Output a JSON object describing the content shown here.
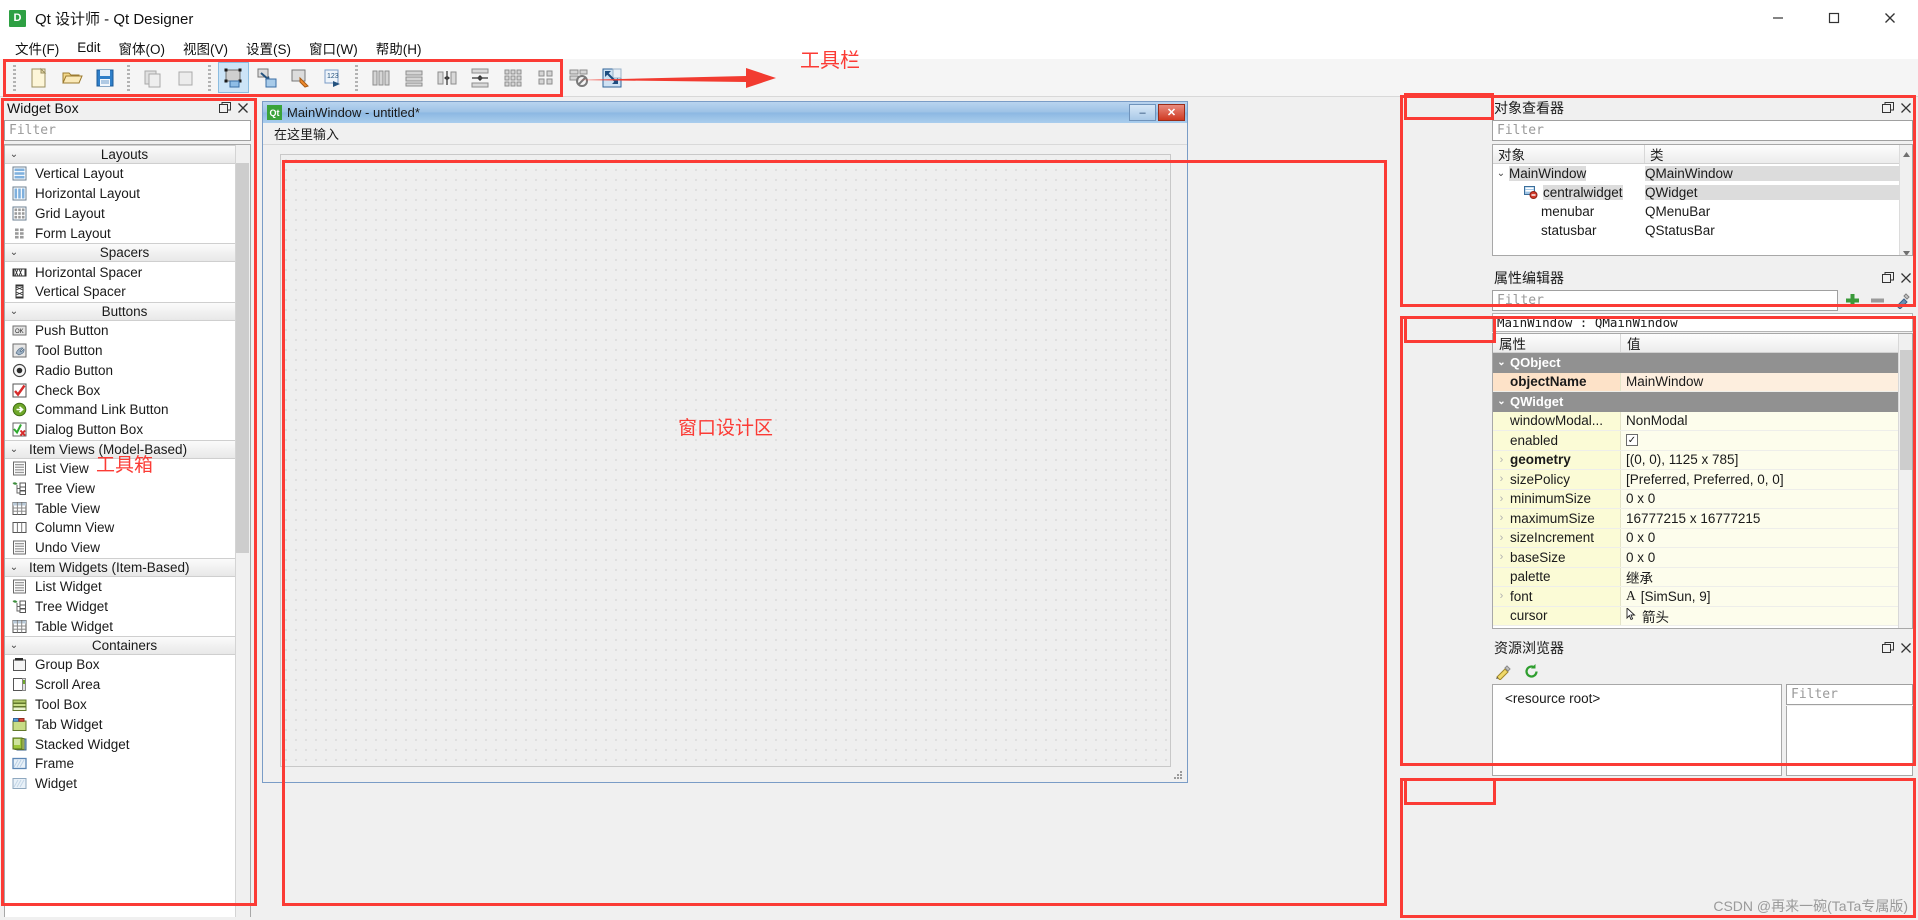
{
  "window": {
    "title": "Qt 设计师 - Qt Designer",
    "logo_letter": "D",
    "minimize_label": "minimize",
    "maximize_label": "maximize",
    "close_label": "close"
  },
  "menubar": {
    "items": [
      {
        "label": "文件(F)",
        "accel": "F"
      },
      {
        "label": "Edit",
        "accel": "E"
      },
      {
        "label": "窗体(O)",
        "accel": "O"
      },
      {
        "label": "视图(V)",
        "accel": "V"
      },
      {
        "label": "设置(S)",
        "accel": "S"
      },
      {
        "label": "窗口(W)",
        "accel": "W"
      },
      {
        "label": "帮助(H)",
        "accel": "H"
      }
    ]
  },
  "toolbar": {
    "buttons": [
      {
        "name": "new-form-icon"
      },
      {
        "name": "open-form-icon"
      },
      {
        "name": "save-form-icon"
      },
      {
        "name": "cut-copy-icon"
      },
      {
        "name": "paste-icon"
      },
      {
        "name": "edit-widgets-icon"
      },
      {
        "name": "edit-signals-slots-icon"
      },
      {
        "name": "edit-buddies-icon"
      },
      {
        "name": "edit-tab-order-icon"
      },
      {
        "name": "layout-horizontally-icon"
      },
      {
        "name": "layout-vertically-icon"
      },
      {
        "name": "layout-in-splitter-horizontal-icon"
      },
      {
        "name": "layout-in-splitter-vertical-icon"
      },
      {
        "name": "layout-in-grid-icon"
      },
      {
        "name": "layout-in-form-icon"
      },
      {
        "name": "break-layout-icon"
      },
      {
        "name": "adjust-size-icon"
      }
    ]
  },
  "annotations": {
    "toolbar_label": "工具栏",
    "widgetbox_label": "工具箱",
    "canvas_label": "窗口设计区"
  },
  "widget_box": {
    "title": "Widget Box",
    "filter_placeholder": "Filter",
    "float_label": "float",
    "close_label": "close",
    "groups": [
      {
        "name": "Layouts",
        "items": [
          {
            "label": "Vertical Layout",
            "icon": "vertical-layout-icon"
          },
          {
            "label": "Horizontal Layout",
            "icon": "horizontal-layout-icon"
          },
          {
            "label": "Grid Layout",
            "icon": "grid-layout-icon"
          },
          {
            "label": "Form Layout",
            "icon": "form-layout-icon"
          }
        ]
      },
      {
        "name": "Spacers",
        "items": [
          {
            "label": "Horizontal Spacer",
            "icon": "horizontal-spacer-icon"
          },
          {
            "label": "Vertical Spacer",
            "icon": "vertical-spacer-icon"
          }
        ]
      },
      {
        "name": "Buttons",
        "items": [
          {
            "label": "Push Button",
            "icon": "push-button-icon"
          },
          {
            "label": "Tool Button",
            "icon": "tool-button-icon"
          },
          {
            "label": "Radio Button",
            "icon": "radio-button-icon"
          },
          {
            "label": "Check Box",
            "icon": "check-box-icon"
          },
          {
            "label": "Command Link Button",
            "icon": "command-link-button-icon"
          },
          {
            "label": "Dialog Button Box",
            "icon": "dialog-button-box-icon"
          }
        ]
      },
      {
        "name": "Item Views (Model-Based)",
        "items": [
          {
            "label": "List View",
            "icon": "list-view-icon"
          },
          {
            "label": "Tree View",
            "icon": "tree-view-icon"
          },
          {
            "label": "Table View",
            "icon": "table-view-icon"
          },
          {
            "label": "Column View",
            "icon": "column-view-icon"
          },
          {
            "label": "Undo View",
            "icon": "undo-view-icon"
          }
        ]
      },
      {
        "name": "Item Widgets (Item-Based)",
        "items": [
          {
            "label": "List Widget",
            "icon": "list-widget-icon"
          },
          {
            "label": "Tree Widget",
            "icon": "tree-widget-icon"
          },
          {
            "label": "Table Widget",
            "icon": "table-widget-icon"
          }
        ]
      },
      {
        "name": "Containers",
        "items": [
          {
            "label": "Group Box",
            "icon": "group-box-icon"
          },
          {
            "label": "Scroll Area",
            "icon": "scroll-area-icon"
          },
          {
            "label": "Tool Box",
            "icon": "tool-box-icon"
          },
          {
            "label": "Tab Widget",
            "icon": "tab-widget-icon"
          },
          {
            "label": "Stacked Widget",
            "icon": "stacked-widget-icon"
          },
          {
            "label": "Frame",
            "icon": "frame-icon"
          },
          {
            "label": "Widget",
            "icon": "widget-icon"
          }
        ]
      }
    ]
  },
  "form_window": {
    "title": "MainWindow - untitled*",
    "logo_letter": "Qt",
    "minimize_label": "–",
    "close_label": "✕",
    "menu_placeholder": "在这里输入"
  },
  "object_inspector": {
    "title": "对象查看器",
    "filter_placeholder": "Filter",
    "columns": [
      "对象",
      "类"
    ],
    "rows": [
      {
        "name": "MainWindow",
        "class": "QMainWindow",
        "depth": 0,
        "expanded": true,
        "selected": true,
        "icon": ""
      },
      {
        "name": "centralwidget",
        "class": "QWidget",
        "depth": 1,
        "expanded": false,
        "selected": true,
        "icon": "central-widget-icon"
      },
      {
        "name": "menubar",
        "class": "QMenuBar",
        "depth": 1,
        "expanded": false,
        "selected": false,
        "icon": ""
      },
      {
        "name": "statusbar",
        "class": "QStatusBar",
        "depth": 1,
        "expanded": false,
        "selected": false,
        "icon": ""
      }
    ]
  },
  "property_editor": {
    "title": "属性编辑器",
    "filter_placeholder": "Filter",
    "object_line": "MainWindow : QMainWindow",
    "columns": [
      "属性",
      "值"
    ],
    "rows": [
      {
        "kind": "group",
        "name": "QObject"
      },
      {
        "kind": "prop",
        "name": "objectName",
        "value": "MainWindow",
        "bold": true,
        "highlight": true,
        "expandable": false
      },
      {
        "kind": "group",
        "name": "QWidget"
      },
      {
        "kind": "prop",
        "name": "windowModal...",
        "value": "NonModal",
        "bold": false,
        "highlight": false,
        "expandable": false
      },
      {
        "kind": "prop",
        "name": "enabled",
        "value": "",
        "checkbox": true,
        "checked": true,
        "bold": false,
        "highlight": false,
        "expandable": false
      },
      {
        "kind": "prop",
        "name": "geometry",
        "value": "[(0, 0), 1125 x 785]",
        "bold": true,
        "highlight": false,
        "expandable": true
      },
      {
        "kind": "prop",
        "name": "sizePolicy",
        "value": "[Preferred, Preferred, 0, 0]",
        "bold": false,
        "highlight": false,
        "expandable": true
      },
      {
        "kind": "prop",
        "name": "minimumSize",
        "value": "0 x 0",
        "bold": false,
        "highlight": false,
        "expandable": true
      },
      {
        "kind": "prop",
        "name": "maximumSize",
        "value": "16777215 x 16777215",
        "bold": false,
        "highlight": false,
        "expandable": true
      },
      {
        "kind": "prop",
        "name": "sizeIncrement",
        "value": "0 x 0",
        "bold": false,
        "highlight": false,
        "expandable": true
      },
      {
        "kind": "prop",
        "name": "baseSize",
        "value": "0 x 0",
        "bold": false,
        "highlight": false,
        "expandable": true
      },
      {
        "kind": "prop",
        "name": "palette",
        "value": "继承",
        "bold": false,
        "highlight": false,
        "expandable": false
      },
      {
        "kind": "prop",
        "name": "font",
        "value": "[SimSun, 9]",
        "prefix": "A",
        "bold": false,
        "highlight": false,
        "expandable": true
      },
      {
        "kind": "prop",
        "name": "cursor",
        "value": "箭头",
        "prefix": "cursor",
        "bold": false,
        "highlight": false,
        "expandable": false
      }
    ]
  },
  "resource_browser": {
    "title": "资源浏览器",
    "edit_icon": "pencil-icon",
    "reload_icon": "reload-icon",
    "root_label": "<resource root>",
    "filter_placeholder": "Filter"
  },
  "watermark": "CSDN @再来一碗(TaTa专属版)",
  "colors": {
    "annotation_red": "#fb3b35",
    "titlebar_active": "#9dc2e6",
    "property_group": "#919191",
    "property_value_bg": "#fdfdec",
    "property_name_bg": "#fbfbd6",
    "highlight_orange": "#fde2c8"
  }
}
